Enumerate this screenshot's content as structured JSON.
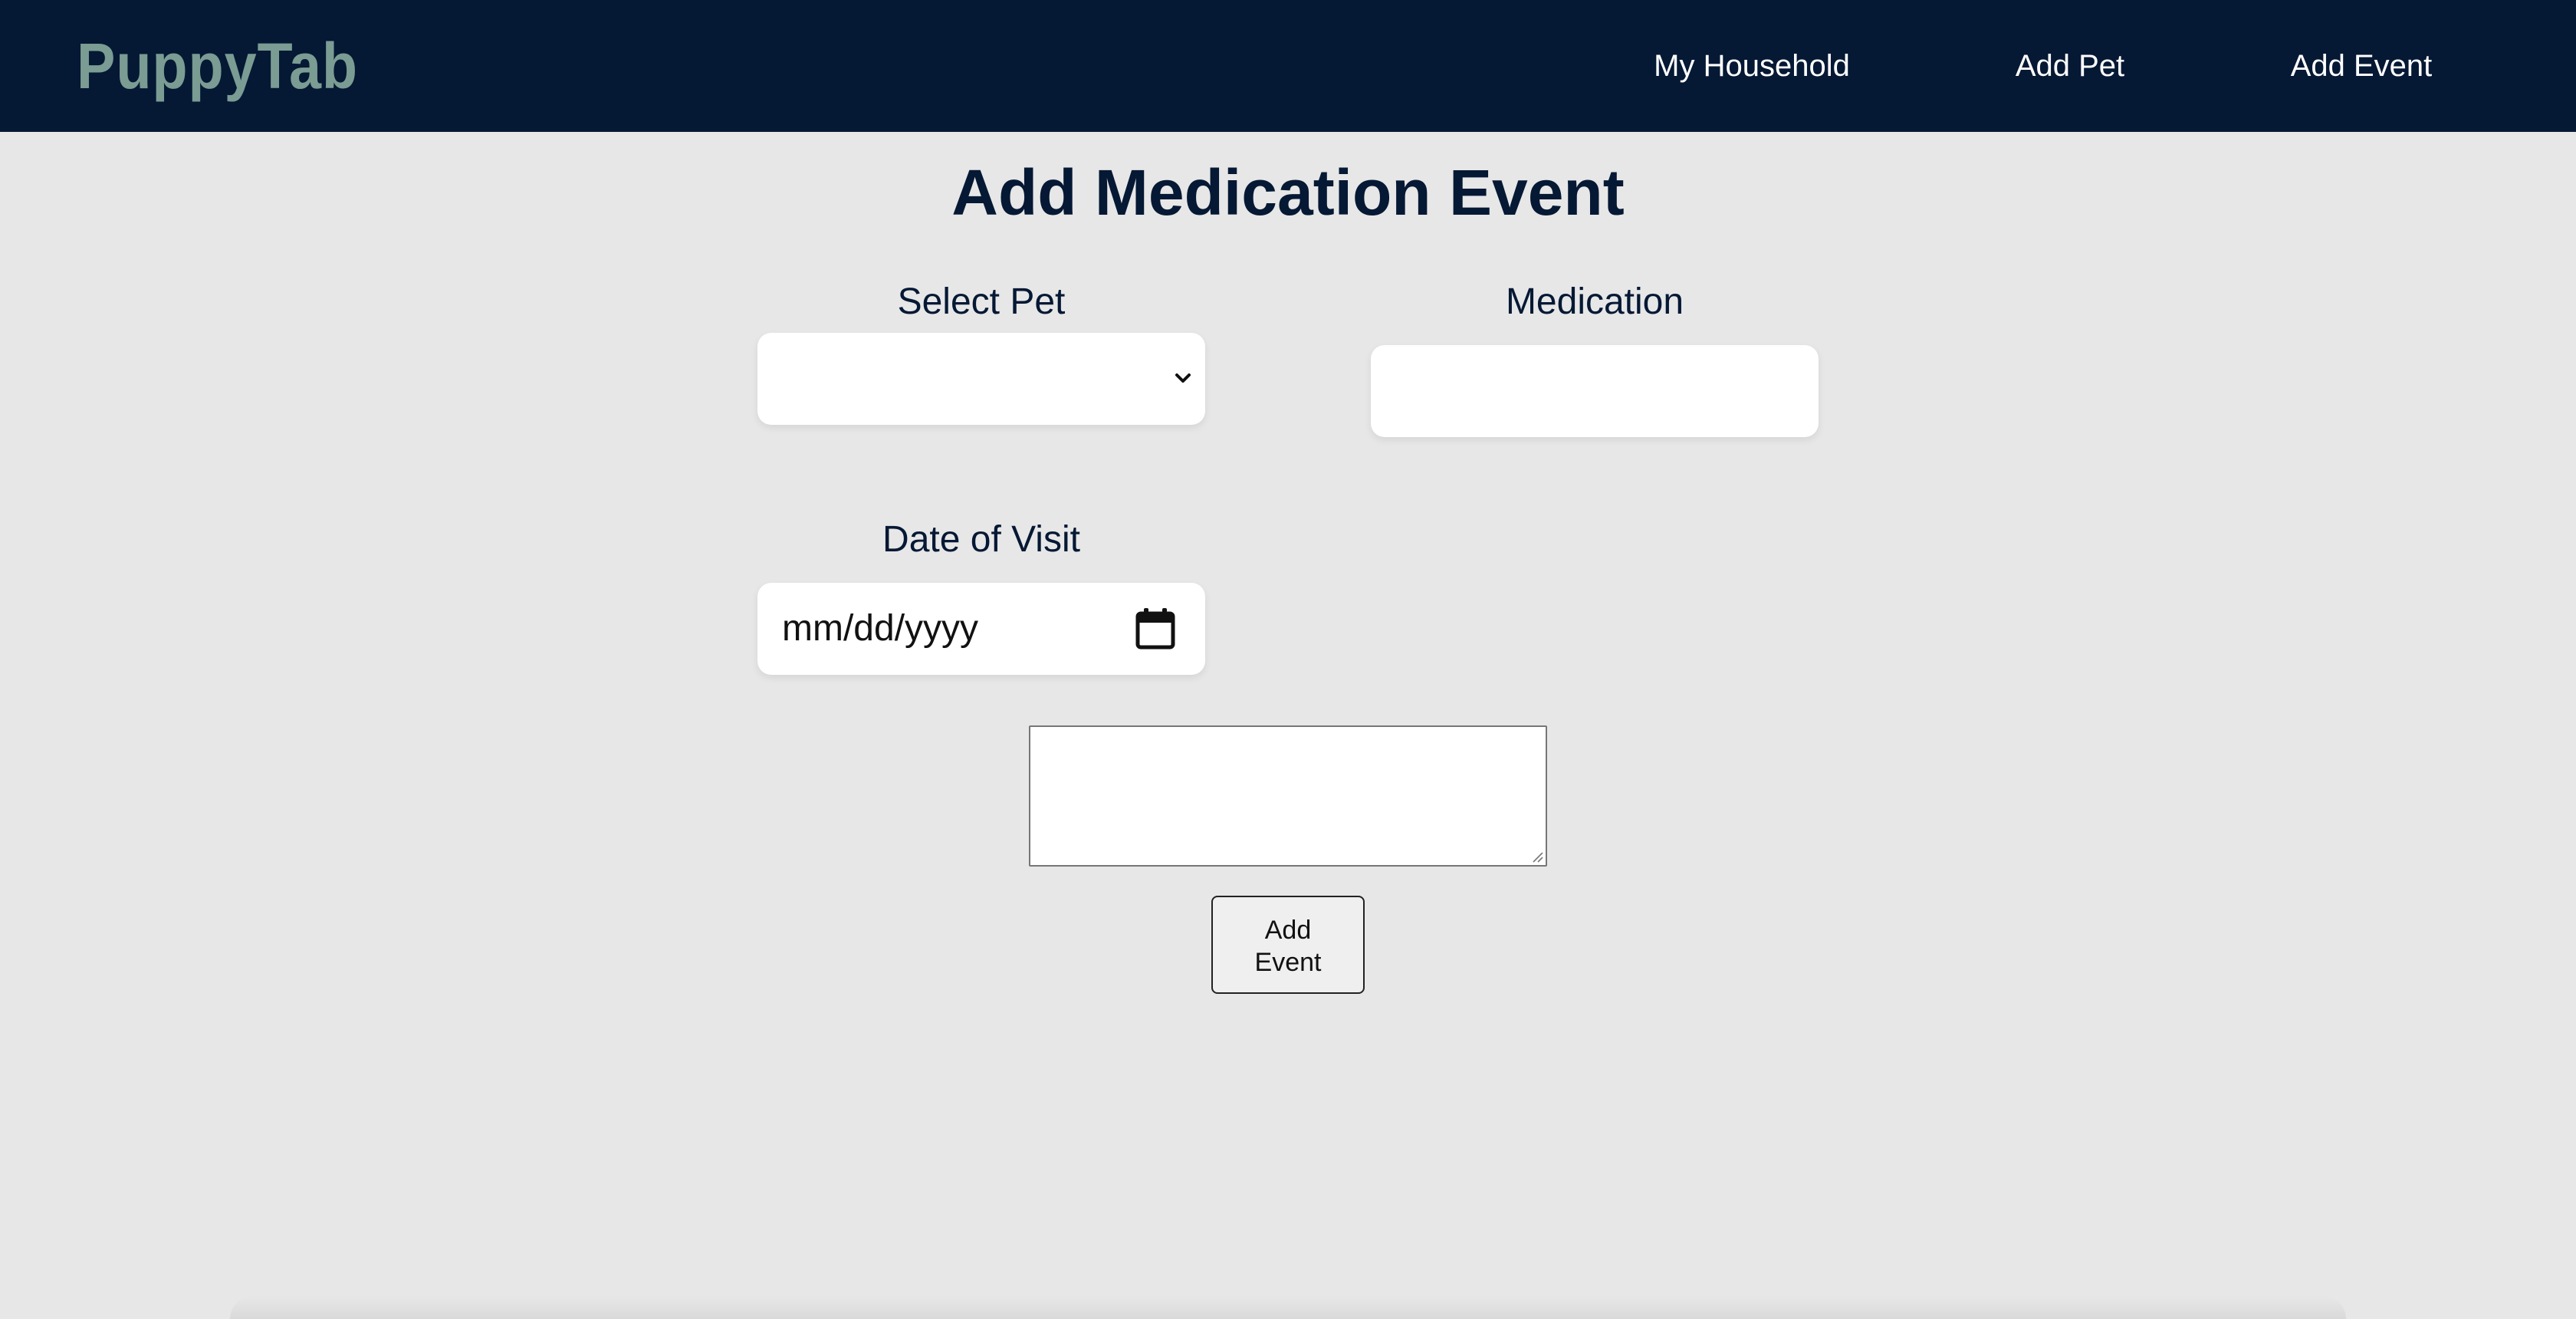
{
  "header": {
    "brand": "PuppyTab",
    "nav": {
      "household": "My Household",
      "add_pet": "Add Pet",
      "add_event": "Add Event"
    }
  },
  "main": {
    "title": "Add Medication Event",
    "fields": {
      "pet_label": "Select Pet",
      "pet_value": "",
      "medication_label": "Medication",
      "medication_value": "",
      "date_label": "Date of Visit",
      "date_placeholder": "mm/dd/yyyy",
      "notes_value": ""
    },
    "submit": {
      "line1": "Add",
      "line2": "Event"
    }
  },
  "icons": {
    "select_chevron": "chevron-down-icon",
    "date_picker": "calendar-icon"
  },
  "colors": {
    "header_bg": "#051834",
    "brand": "#7a9c93",
    "page_bg": "#e7e7e7",
    "title": "#051834"
  }
}
